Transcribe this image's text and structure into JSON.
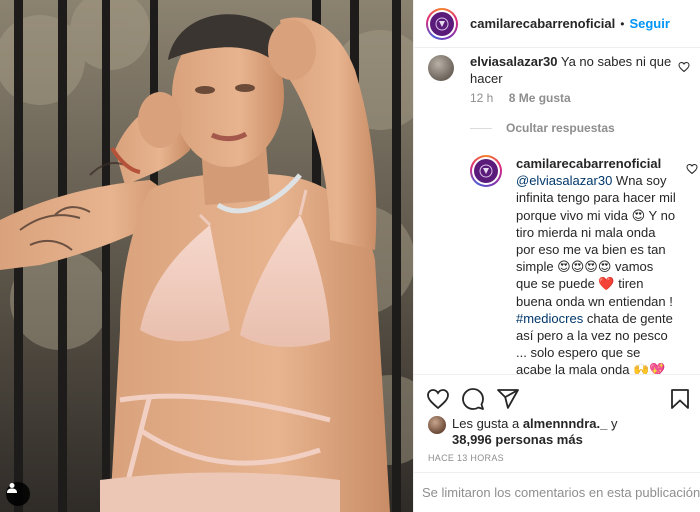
{
  "post": {
    "author": "camilarecabarrenoficial",
    "separator": "•",
    "follow_label": "Seguir"
  },
  "comments": [
    {
      "username": "elviasalazar30",
      "text": "Ya no sabes ni que hacer",
      "time": "12 h",
      "likes": "8 Me gusta"
    }
  ],
  "hide_replies_label": "Ocultar respuestas",
  "reply": {
    "username": "camilarecabarrenoficial",
    "mention": "@elviasalazar30",
    "text_1": " Wna soy infinita tengo para hacer mil porque vivo mi vida 😍 Y no tiro mierda ni mala onda por eso me va bien es tan simple 😍😍😍😍 vamos que se puede ❤️ tiren buena onda wn entiendan ! ",
    "hashtag": "#mediocres",
    "text_2": " chata de gente así pero a la vez no pesco ... solo espero que se acabe la mala onda 🙌💖"
  },
  "liked_by": {
    "prefix": "Les gusta a ",
    "user": "almennndra._",
    "suffix": " y",
    "count": "38,996 personas más"
  },
  "timestamp": "HACE 13 HORAS",
  "comments_limited": "Se limitaron los comentarios en esta publicación.",
  "icons": {
    "like": "heart-icon",
    "comment": "comment-icon",
    "share": "share-icon",
    "save": "bookmark-icon",
    "user_tag": "user-tag-icon"
  },
  "colors": {
    "link": "#0095f6",
    "mention": "#00376b",
    "muted": "#8e8e8e"
  }
}
